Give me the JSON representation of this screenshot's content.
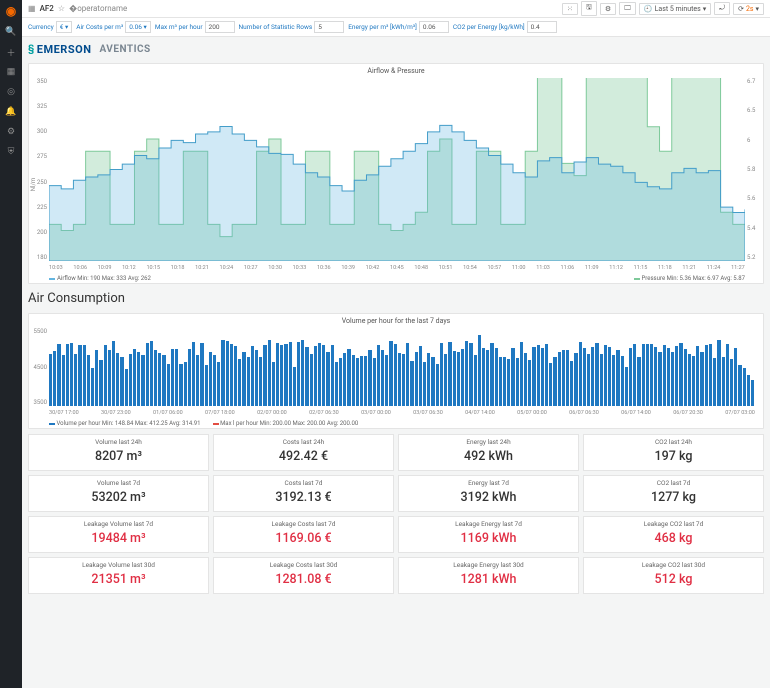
{
  "page_title": "AF2",
  "time_range": "Last 5 minutes",
  "refresh_interval": "2s",
  "variables": [
    {
      "label": "Currency",
      "value": "€",
      "type": "select"
    },
    {
      "label": "Air Costs per m³",
      "value": "0.06",
      "type": "select"
    },
    {
      "label": "Max m³ per hour",
      "value": "200",
      "type": "input"
    },
    {
      "label": "Number of Statistic Rows",
      "value": "5",
      "type": "input"
    },
    {
      "label": "Energy per m³ [kWh/m³]",
      "value": "0.06",
      "type": "input"
    },
    {
      "label": "CO2 per Energy [kg/kWh]",
      "value": "0.4",
      "type": "input"
    }
  ],
  "brand1": "EMERSON",
  "brand2": "AVENTICS",
  "panel1": {
    "title": "Airflow & Pressure",
    "ylabel": "Nl/m",
    "legend_left": "Airflow  Min: 190  Max: 333  Avg: 262",
    "legend_right": "Pressure  Min: 5.36  Max: 6.97  Avg: 5.87",
    "color_airflow": "#64b5e0",
    "color_pressure": "#7ec99a"
  },
  "section2_title": "Air Consumption",
  "panel2": {
    "title": "Volume per hour for the last 7 days",
    "legend_left": "Volume per hour  Min: 148.84  Max: 412.25  Avg: 314.91",
    "legend_right": "Max l per hour  Min: 200.00  Max: 200.00  Avg: 200.00"
  },
  "stats": [
    {
      "title": "Volume last 24h",
      "value": "8207 m³",
      "red": false
    },
    {
      "title": "Costs last 24h",
      "value": "492.42 €",
      "red": false
    },
    {
      "title": "Energy last 24h",
      "value": "492 kWh",
      "red": false
    },
    {
      "title": "CO2 last 24h",
      "value": "197 kg",
      "red": false
    },
    {
      "title": "Volume last 7d",
      "value": "53202 m³",
      "red": false
    },
    {
      "title": "Costs last 7d",
      "value": "3192.13 €",
      "red": false
    },
    {
      "title": "Energy last 7d",
      "value": "3192 kWh",
      "red": false
    },
    {
      "title": "CO2 last 7d",
      "value": "1277 kg",
      "red": false
    },
    {
      "title": "Leakage Volume last 7d",
      "value": "19484 m³",
      "red": true
    },
    {
      "title": "Leakage Costs last 7d",
      "value": "1169.06 €",
      "red": true
    },
    {
      "title": "Leakage Energy last 7d",
      "value": "1169 kWh",
      "red": true
    },
    {
      "title": "Leakage CO2 last 7d",
      "value": "468 kg",
      "red": true
    },
    {
      "title": "Leakage Volume last 30d",
      "value": "21351 m³",
      "red": true
    },
    {
      "title": "Leakage Costs last 30d",
      "value": "1281.08 €",
      "red": true
    },
    {
      "title": "Leakage Energy last 30d",
      "value": "1281 kWh",
      "red": true
    },
    {
      "title": "Leakage CO2 last 30d",
      "value": "512 kg",
      "red": true
    }
  ],
  "chart_data": [
    {
      "type": "line",
      "title": "Airflow & Pressure",
      "series": [
        {
          "name": "Airflow",
          "yaxis": "left",
          "unit": "Nl/m",
          "min": 190,
          "max": 333,
          "avg": 262,
          "values": [
            250,
            247,
            255,
            258,
            260,
            265,
            270,
            278,
            275,
            285,
            292,
            290,
            298,
            300,
            305,
            298,
            292,
            286,
            280,
            279,
            270,
            262,
            258,
            250,
            245,
            255,
            260,
            268,
            275,
            282,
            289,
            300,
            306,
            300,
            292,
            285,
            278,
            270,
            262,
            258,
            273,
            276,
            262,
            272,
            276,
            270,
            268,
            262,
            253,
            249,
            247,
            262,
            266,
            262,
            264,
            230,
            225,
            228
          ]
        },
        {
          "name": "Pressure",
          "yaxis": "right",
          "unit": "bar",
          "min": 5.36,
          "max": 6.97,
          "avg": 5.87,
          "values": [
            5.5,
            5.45,
            5.5,
            6.1,
            6.1,
            5.5,
            5.5,
            6.1,
            6.2,
            5.5,
            5.5,
            6.1,
            6.1,
            5.5,
            5.4,
            5.5,
            5.5,
            6.1,
            6.2,
            5.5,
            5.5,
            6.1,
            6.1,
            5.5,
            5.5,
            6.1,
            6.1,
            5.5,
            5.45,
            5.5,
            5.6,
            6.1,
            6.2,
            5.5,
            5.5,
            6.1,
            6.1,
            5.5,
            5.5,
            6.1,
            6.97,
            6.95,
            6.0,
            5.9,
            6.95,
            6.9,
            6.95,
            6.9,
            6.9,
            6.3,
            6.1,
            6.9,
            6.9,
            6.85,
            6.9,
            5.6,
            5.5,
            5.55
          ]
        }
      ],
      "x_ticks": [
        "10:03",
        "10:06",
        "10:09",
        "10:12",
        "10:15",
        "10:18",
        "10:21",
        "10:24",
        "10:27",
        "10:30",
        "10:33",
        "10:36",
        "10:39",
        "10:42",
        "10:45",
        "10:48",
        "10:51",
        "10:54",
        "10:57",
        "11:00",
        "11:03",
        "11:06",
        "11:09",
        "11:12",
        "11:15",
        "11:18",
        "11:21",
        "11:24",
        "11:27"
      ],
      "y_left": {
        "min": 180,
        "max": 350,
        "ticks": [
          350,
          325,
          300,
          275,
          250,
          225,
          200,
          180
        ]
      },
      "y_right": {
        "min": 5.2,
        "max": 6.7,
        "ticks": [
          6.7,
          6.5,
          6.0,
          5.8,
          5.6,
          5.4,
          5.2
        ]
      }
    },
    {
      "type": "bar",
      "title": "Volume per hour for the last 7 days",
      "series": [
        {
          "name": "Volume per hour",
          "min": 148.84,
          "max": 412.25,
          "avg": 314.91,
          "values": [
            302,
            317,
            360,
            297,
            356,
            361,
            300,
            353,
            353,
            293,
            222,
            322,
            267,
            354,
            325,
            373,
            307,
            284,
            215,
            300,
            330,
            314,
            297,
            361,
            373,
            321,
            307,
            296,
            245,
            327,
            331,
            240,
            252,
            330,
            371,
            293,
            362,
            236,
            313,
            296,
            254,
            381,
            373,
            355,
            347,
            272,
            313,
            282,
            345,
            323,
            283,
            350,
            378,
            255,
            366,
            353,
            355,
            371,
            225,
            369,
            381,
            341,
            299,
            347,
            364,
            350,
            310,
            353,
            254,
            278,
            305,
            327,
            292,
            276,
            291,
            289,
            321,
            276,
            352,
            322,
            297,
            375,
            359,
            306,
            302,
            365,
            261,
            313,
            349,
            253,
            303,
            283,
            243,
            363,
            298,
            369,
            319,
            314,
            328,
            374,
            364,
            295,
            410,
            332,
            326,
            364,
            335,
            282,
            284,
            271,
            333,
            277,
            370,
            304,
            263,
            340,
            354,
            335,
            358,
            249,
            281,
            310,
            323,
            324,
            262,
            306,
            371,
            332,
            299,
            339,
            361,
            298,
            352,
            343,
            297,
            325,
            290,
            223,
            334,
            360,
            283,
            356,
            355,
            355,
            339,
            313,
            354,
            337,
            312,
            344,
            366,
            327,
            301,
            287,
            348,
            313,
            352,
            359,
            276,
            380,
            282,
            360,
            274,
            332,
            238,
            219,
            179,
            149
          ]
        },
        {
          "name": "Max l per hour",
          "min": 200,
          "max": 200,
          "avg": 200,
          "values": [
            200
          ]
        }
      ],
      "x_ticks": [
        "30/07 17:00",
        "30/07 23:00",
        "01/07 06:00",
        "07/07 18:00",
        "02/07 00:00",
        "02/07 06:30",
        "03/07 00:00",
        "03/07 06:30",
        "04/07 14:00",
        "05/07 00:00",
        "06/07 06:30",
        "06/07 14:00",
        "06/07 20:30",
        "07/07 03:00"
      ],
      "ylim": [
        0,
        5500
      ],
      "y_ticks": [
        5500,
        4500,
        3500
      ]
    }
  ]
}
